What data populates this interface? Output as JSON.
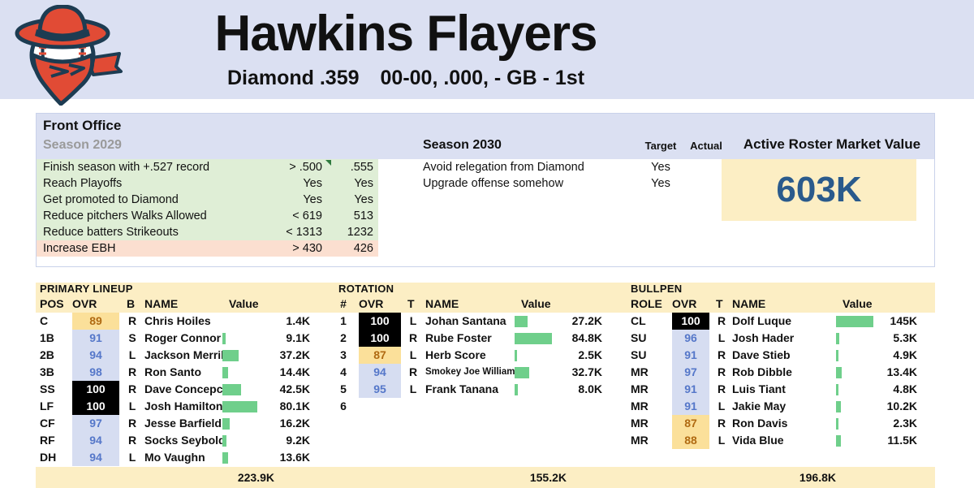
{
  "header": {
    "team_name": "Hawkins Flayers",
    "league": "Diamond .359",
    "record": "00-00, .000, - GB - 1st",
    "logo_icon": "cowboy-baseball-logo",
    "bg_color": "#dbe0f2"
  },
  "front_office": {
    "title": "Front Office",
    "past_season_label": "Season 2029",
    "current_season_label": "Season 2030",
    "col_target": "Target",
    "col_actual": "Actual",
    "past_goals": [
      {
        "label": "Finish season with +.527 record",
        "target": "> .500",
        "actual": ".555",
        "status": "ok",
        "marker": true
      },
      {
        "label": "Reach Playoffs",
        "target": "Yes",
        "actual": "Yes",
        "status": "ok",
        "marker": false
      },
      {
        "label": "Get promoted to Diamond",
        "target": "Yes",
        "actual": "Yes",
        "status": "ok",
        "marker": false
      },
      {
        "label": "Reduce pitchers Walks Allowed",
        "target": "< 619",
        "actual": "513",
        "status": "ok",
        "marker": false
      },
      {
        "label": "Reduce batters Strikeouts",
        "target": "< 1313",
        "actual": "1232",
        "status": "ok",
        "marker": false
      },
      {
        "label": "Increase EBH",
        "target": "> 430",
        "actual": "426",
        "status": "fail",
        "marker": false
      }
    ],
    "current_goals": [
      {
        "label": "Avoid relegation from Diamond",
        "target": "Yes",
        "actual": ""
      },
      {
        "label": "Upgrade offense somehow",
        "target": "Yes",
        "actual": ""
      }
    ],
    "market_value": {
      "title": "Active Roster Market Value",
      "value": "603K",
      "box_color": "#fceec4",
      "text_color": "#2a5a8c"
    }
  },
  "lineup": {
    "title": "PRIMARY LINEUP",
    "columns": {
      "pos": "POS",
      "ovr": "OVR",
      "hand": "B",
      "name": "NAME",
      "value": "Value"
    },
    "rows": [
      {
        "pos": "C",
        "ovr": "89",
        "tier": "amber",
        "hand": "R",
        "name": "Chris Hoiles",
        "value": "1.4K",
        "bar": 0
      },
      {
        "pos": "1B",
        "ovr": "91",
        "tier": "blue",
        "hand": "S",
        "name": "Roger Connor",
        "value": "9.1K",
        "bar": 4
      },
      {
        "pos": "2B",
        "ovr": "94",
        "tier": "blue",
        "hand": "L",
        "name": "Jackson Merrill",
        "value": "37.2K",
        "bar": 20
      },
      {
        "pos": "3B",
        "ovr": "98",
        "tier": "blue",
        "hand": "R",
        "name": "Ron Santo",
        "value": "14.4K",
        "bar": 7
      },
      {
        "pos": "SS",
        "ovr": "100",
        "tier": "hi",
        "hand": "R",
        "name": "Dave Concepcion",
        "value": "42.5K",
        "bar": 23
      },
      {
        "pos": "LF",
        "ovr": "100",
        "tier": "hi",
        "hand": "L",
        "name": "Josh Hamilton",
        "value": "80.1K",
        "bar": 43
      },
      {
        "pos": "CF",
        "ovr": "97",
        "tier": "blue",
        "hand": "R",
        "name": "Jesse Barfield",
        "value": "16.2K",
        "bar": 9
      },
      {
        "pos": "RF",
        "ovr": "94",
        "tier": "blue",
        "hand": "R",
        "name": "Socks Seybold",
        "value": "9.2K",
        "bar": 5
      },
      {
        "pos": "DH",
        "ovr": "94",
        "tier": "blue",
        "hand": "L",
        "name": "Mo Vaughn",
        "value": "13.6K",
        "bar": 7
      }
    ],
    "total": "223.9K"
  },
  "rotation": {
    "title": "ROTATION",
    "columns": {
      "pos": "#",
      "ovr": "OVR",
      "hand": "T",
      "name": "NAME",
      "value": "Value"
    },
    "rows": [
      {
        "pos": "1",
        "ovr": "100",
        "tier": "hi",
        "hand": "L",
        "name": "Johan Santana",
        "value": "27.2K",
        "bar": 16,
        "small": false
      },
      {
        "pos": "2",
        "ovr": "100",
        "tier": "hi",
        "hand": "R",
        "name": "Rube Foster",
        "value": "84.8K",
        "bar": 46,
        "small": false
      },
      {
        "pos": "3",
        "ovr": "87",
        "tier": "amber",
        "hand": "L",
        "name": "Herb Score",
        "value": "2.5K",
        "bar": 3,
        "small": false
      },
      {
        "pos": "4",
        "ovr": "94",
        "tier": "blue",
        "hand": "R",
        "name": "Smokey Joe Williams",
        "value": "32.7K",
        "bar": 18,
        "small": true
      },
      {
        "pos": "5",
        "ovr": "95",
        "tier": "blue",
        "hand": "L",
        "name": "Frank Tanana",
        "value": "8.0K",
        "bar": 4,
        "small": false
      },
      {
        "pos": "6",
        "ovr": "",
        "tier": "empty",
        "hand": "",
        "name": "",
        "value": "",
        "bar": 0,
        "small": false
      }
    ],
    "total": "155.2K"
  },
  "bullpen": {
    "title": "BULLPEN",
    "columns": {
      "pos": "ROLE",
      "ovr": "OVR",
      "hand": "T",
      "name": "NAME",
      "value": "Value"
    },
    "rows": [
      {
        "pos": "CL",
        "ovr": "100",
        "tier": "hi",
        "hand": "R",
        "name": "Dolf Luque",
        "value": "145K",
        "bar": 46
      },
      {
        "pos": "SU",
        "ovr": "96",
        "tier": "blue",
        "hand": "L",
        "name": "Josh Hader",
        "value": "5.3K",
        "bar": 4
      },
      {
        "pos": "SU",
        "ovr": "91",
        "tier": "blue",
        "hand": "R",
        "name": "Dave Stieb",
        "value": "4.9K",
        "bar": 3
      },
      {
        "pos": "MR",
        "ovr": "97",
        "tier": "blue",
        "hand": "R",
        "name": "Rob Dibble",
        "value": "13.4K",
        "bar": 7
      },
      {
        "pos": "MR",
        "ovr": "91",
        "tier": "blue",
        "hand": "R",
        "name": "Luis Tiant",
        "value": "4.8K",
        "bar": 3
      },
      {
        "pos": "MR",
        "ovr": "91",
        "tier": "blue",
        "hand": "L",
        "name": "Jakie May",
        "value": "10.2K",
        "bar": 6
      },
      {
        "pos": "MR",
        "ovr": "87",
        "tier": "amber",
        "hand": "R",
        "name": "Ron Davis",
        "value": "2.3K",
        "bar": 3
      },
      {
        "pos": "MR",
        "ovr": "88",
        "tier": "amber",
        "hand": "L",
        "name": "Vida Blue",
        "value": "11.5K",
        "bar": 6
      }
    ],
    "total": "196.8K"
  }
}
